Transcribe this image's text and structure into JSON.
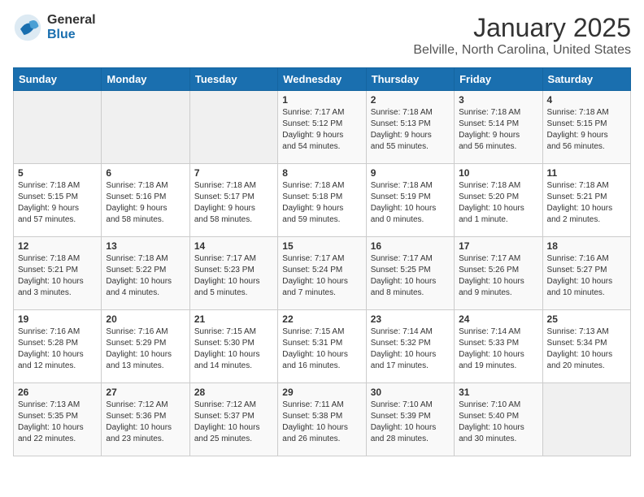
{
  "header": {
    "logo_general": "General",
    "logo_blue": "Blue",
    "title": "January 2025",
    "subtitle": "Belville, North Carolina, United States"
  },
  "weekdays": [
    "Sunday",
    "Monday",
    "Tuesday",
    "Wednesday",
    "Thursday",
    "Friday",
    "Saturday"
  ],
  "weeks": [
    [
      {
        "day": "",
        "info": ""
      },
      {
        "day": "",
        "info": ""
      },
      {
        "day": "",
        "info": ""
      },
      {
        "day": "1",
        "info": "Sunrise: 7:17 AM\nSunset: 5:12 PM\nDaylight: 9 hours\nand 54 minutes."
      },
      {
        "day": "2",
        "info": "Sunrise: 7:18 AM\nSunset: 5:13 PM\nDaylight: 9 hours\nand 55 minutes."
      },
      {
        "day": "3",
        "info": "Sunrise: 7:18 AM\nSunset: 5:14 PM\nDaylight: 9 hours\nand 56 minutes."
      },
      {
        "day": "4",
        "info": "Sunrise: 7:18 AM\nSunset: 5:15 PM\nDaylight: 9 hours\nand 56 minutes."
      }
    ],
    [
      {
        "day": "5",
        "info": "Sunrise: 7:18 AM\nSunset: 5:15 PM\nDaylight: 9 hours\nand 57 minutes."
      },
      {
        "day": "6",
        "info": "Sunrise: 7:18 AM\nSunset: 5:16 PM\nDaylight: 9 hours\nand 58 minutes."
      },
      {
        "day": "7",
        "info": "Sunrise: 7:18 AM\nSunset: 5:17 PM\nDaylight: 9 hours\nand 58 minutes."
      },
      {
        "day": "8",
        "info": "Sunrise: 7:18 AM\nSunset: 5:18 PM\nDaylight: 9 hours\nand 59 minutes."
      },
      {
        "day": "9",
        "info": "Sunrise: 7:18 AM\nSunset: 5:19 PM\nDaylight: 10 hours\nand 0 minutes."
      },
      {
        "day": "10",
        "info": "Sunrise: 7:18 AM\nSunset: 5:20 PM\nDaylight: 10 hours\nand 1 minute."
      },
      {
        "day": "11",
        "info": "Sunrise: 7:18 AM\nSunset: 5:21 PM\nDaylight: 10 hours\nand 2 minutes."
      }
    ],
    [
      {
        "day": "12",
        "info": "Sunrise: 7:18 AM\nSunset: 5:21 PM\nDaylight: 10 hours\nand 3 minutes."
      },
      {
        "day": "13",
        "info": "Sunrise: 7:18 AM\nSunset: 5:22 PM\nDaylight: 10 hours\nand 4 minutes."
      },
      {
        "day": "14",
        "info": "Sunrise: 7:17 AM\nSunset: 5:23 PM\nDaylight: 10 hours\nand 5 minutes."
      },
      {
        "day": "15",
        "info": "Sunrise: 7:17 AM\nSunset: 5:24 PM\nDaylight: 10 hours\nand 7 minutes."
      },
      {
        "day": "16",
        "info": "Sunrise: 7:17 AM\nSunset: 5:25 PM\nDaylight: 10 hours\nand 8 minutes."
      },
      {
        "day": "17",
        "info": "Sunrise: 7:17 AM\nSunset: 5:26 PM\nDaylight: 10 hours\nand 9 minutes."
      },
      {
        "day": "18",
        "info": "Sunrise: 7:16 AM\nSunset: 5:27 PM\nDaylight: 10 hours\nand 10 minutes."
      }
    ],
    [
      {
        "day": "19",
        "info": "Sunrise: 7:16 AM\nSunset: 5:28 PM\nDaylight: 10 hours\nand 12 minutes."
      },
      {
        "day": "20",
        "info": "Sunrise: 7:16 AM\nSunset: 5:29 PM\nDaylight: 10 hours\nand 13 minutes."
      },
      {
        "day": "21",
        "info": "Sunrise: 7:15 AM\nSunset: 5:30 PM\nDaylight: 10 hours\nand 14 minutes."
      },
      {
        "day": "22",
        "info": "Sunrise: 7:15 AM\nSunset: 5:31 PM\nDaylight: 10 hours\nand 16 minutes."
      },
      {
        "day": "23",
        "info": "Sunrise: 7:14 AM\nSunset: 5:32 PM\nDaylight: 10 hours\nand 17 minutes."
      },
      {
        "day": "24",
        "info": "Sunrise: 7:14 AM\nSunset: 5:33 PM\nDaylight: 10 hours\nand 19 minutes."
      },
      {
        "day": "25",
        "info": "Sunrise: 7:13 AM\nSunset: 5:34 PM\nDaylight: 10 hours\nand 20 minutes."
      }
    ],
    [
      {
        "day": "26",
        "info": "Sunrise: 7:13 AM\nSunset: 5:35 PM\nDaylight: 10 hours\nand 22 minutes."
      },
      {
        "day": "27",
        "info": "Sunrise: 7:12 AM\nSunset: 5:36 PM\nDaylight: 10 hours\nand 23 minutes."
      },
      {
        "day": "28",
        "info": "Sunrise: 7:12 AM\nSunset: 5:37 PM\nDaylight: 10 hours\nand 25 minutes."
      },
      {
        "day": "29",
        "info": "Sunrise: 7:11 AM\nSunset: 5:38 PM\nDaylight: 10 hours\nand 26 minutes."
      },
      {
        "day": "30",
        "info": "Sunrise: 7:10 AM\nSunset: 5:39 PM\nDaylight: 10 hours\nand 28 minutes."
      },
      {
        "day": "31",
        "info": "Sunrise: 7:10 AM\nSunset: 5:40 PM\nDaylight: 10 hours\nand 30 minutes."
      },
      {
        "day": "",
        "info": ""
      }
    ]
  ]
}
